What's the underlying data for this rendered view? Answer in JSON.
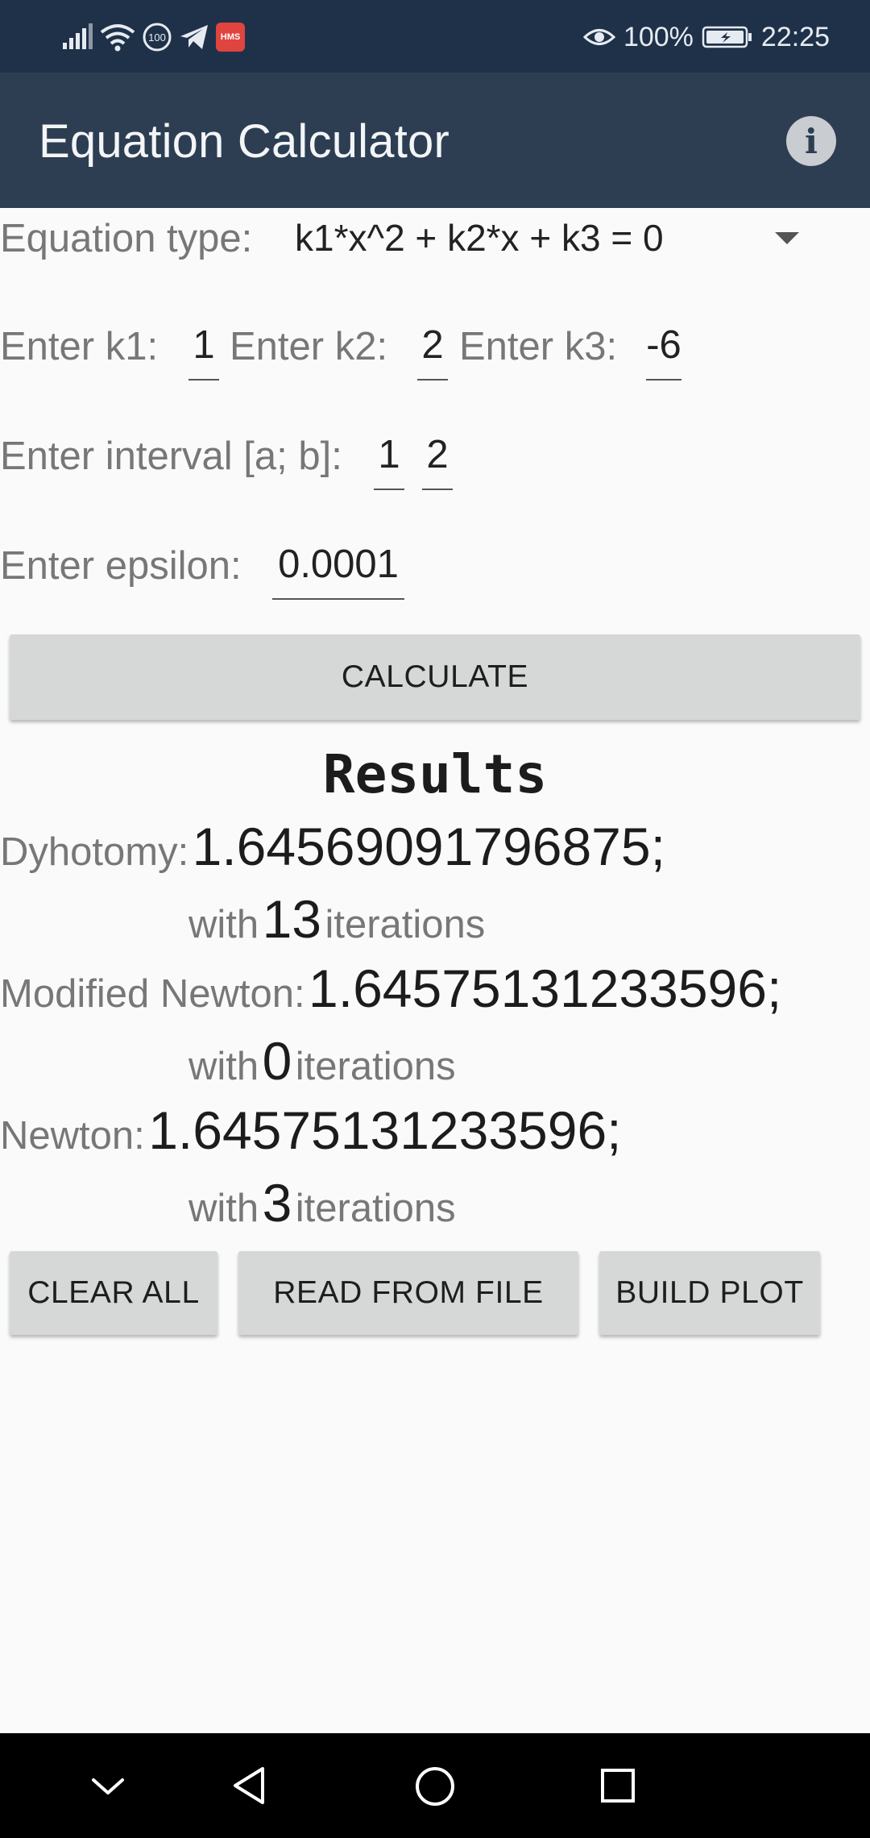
{
  "status_bar": {
    "icons_left": [
      "signal-icon",
      "wifi-icon",
      "data-saver-icon",
      "telegram-icon",
      "hms-app-icon"
    ],
    "hms_label": "HMS",
    "speed_label": "100",
    "battery_percent": "100%",
    "time": "22:25"
  },
  "app_bar": {
    "title": "Equation Calculator",
    "info_icon": "i"
  },
  "form": {
    "equation_type_label": "Equation type:",
    "equation_type_value": "k1*x^2 + k2*x + k3 = 0",
    "k1_label": "Enter k1:",
    "k1_value": "1",
    "k2_label": "Enter k2:",
    "k2_value": "2",
    "k3_label": "Enter k3:",
    "k3_value": "-6",
    "interval_label": "Enter interval [a; b]:",
    "interval_a": "1",
    "interval_b": "2",
    "epsilon_label": "Enter epsilon:",
    "epsilon_value": "0.0001",
    "calculate_label": "CALCULATE"
  },
  "results": {
    "title": "Results",
    "dyhotomy_label": "Dyhotomy:",
    "dyhotomy_value": "1.64569091796875;",
    "dyhotomy_with": "with",
    "dyhotomy_iterations": "13",
    "dyhotomy_iter_label": "iterations",
    "modified_newton_label": "Modified Newton:",
    "modified_newton_value": "1.64575131233596;",
    "modified_newton_with": "with",
    "modified_newton_iterations": "0",
    "modified_newton_iter_label": "iterations",
    "newton_label": "Newton:",
    "newton_value": "1.64575131233596;",
    "newton_with": "with",
    "newton_iterations": "3",
    "newton_iter_label": "iterations"
  },
  "actions": {
    "clear_all": "CLEAR ALL",
    "read_from_file": "READ FROM FILE",
    "build_plot": "BUILD PLOT"
  },
  "nav_bar": {
    "icons": [
      "back-chevron-icon",
      "back-triangle-icon",
      "home-circle-icon",
      "recents-square-icon"
    ]
  }
}
